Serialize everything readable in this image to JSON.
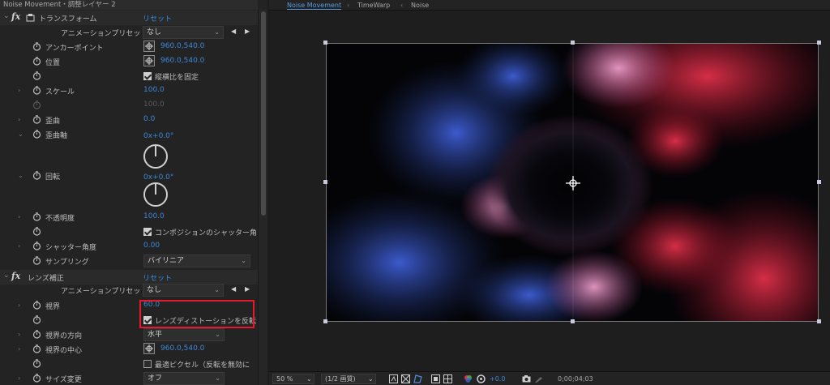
{
  "effect_controls": {
    "title": "Noise Movement・調整レイヤー 2",
    "transform": {
      "name": "トランスフォーム",
      "reset": "リセット",
      "anim_preset_label": "アニメーションプリセット：",
      "anim_preset_value": "なし",
      "anchor_label": "アンカーポイント",
      "anchor_value": "960.0,540.0",
      "position_label": "位置",
      "position_value": "960.0,540.0",
      "uniform_scale_label": "縦横比を固定",
      "scale_label": "スケール",
      "scale_value": "100.0",
      "scale_dim_value": "100.0",
      "skew_label": "歪曲",
      "skew_value": "0.0",
      "skew_axis_label": "歪曲軸",
      "skew_axis_value": "0x+0.0°",
      "rotation_label": "回転",
      "rotation_value": "0x+0.0°",
      "opacity_label": "不透明度",
      "opacity_value": "100.0",
      "comp_shutter_label": "コンポジションのシャッター角",
      "shutter_angle_label": "シャッター角度",
      "shutter_angle_value": "0.00",
      "sampling_label": "サンプリング",
      "sampling_value": "バイリニア"
    },
    "lens": {
      "name": "レンズ補正",
      "reset": "リセット",
      "anim_preset_label": "アニメーションプリセット：",
      "anim_preset_value": "なし",
      "fov_label": "視界",
      "fov_value": "60.0",
      "reverse_label": "レンズディストーションを反転",
      "fov_orientation_label": "視界の方向",
      "fov_orientation_value": "水平",
      "fov_center_label": "視界の中心",
      "fov_center_value": "960.0,540.0",
      "optimal_pixels_label": "最適ピクセル（反転を無効に",
      "resize_label": "サイズ変更",
      "resize_value": "オフ"
    },
    "arrows": {
      "prev": "◀",
      "next": "▶"
    }
  },
  "composition": {
    "tabs": [
      {
        "label": "Noise Movement",
        "active": true
      },
      {
        "label": "TimeWarp",
        "active": false
      },
      {
        "label": "Noise",
        "active": false
      }
    ],
    "tab_sep": "‹",
    "zoom": "50 %",
    "resolution": "(1/2 画質)",
    "exposure": "+0.0",
    "timecode": "0;00;04;03",
    "colors": {
      "red": "#e8192b",
      "accent": "#3c88d8"
    }
  }
}
